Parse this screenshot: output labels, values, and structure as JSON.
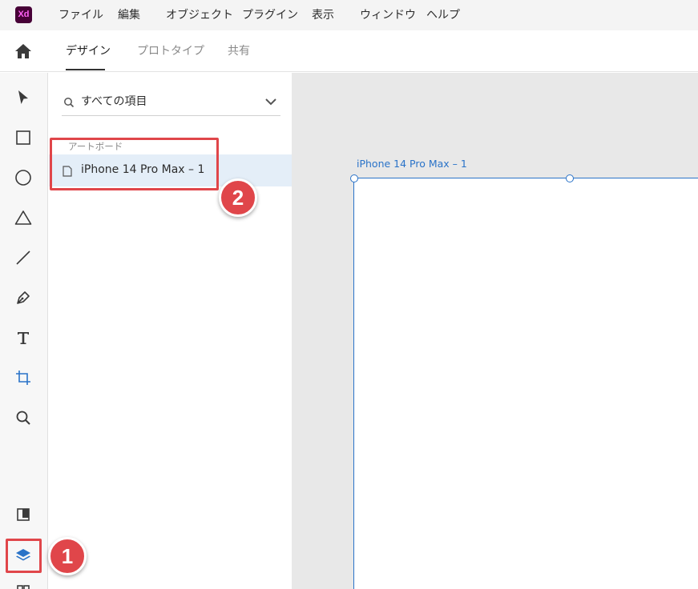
{
  "app": {
    "logo_text": "Xd",
    "logo_color": "#470137",
    "logo_text_color": "#ff61f6"
  },
  "menu": {
    "items": [
      {
        "label": "ファイル"
      },
      {
        "label": "編集"
      },
      {
        "label": "オブジェクト"
      },
      {
        "label": "プラグイン"
      },
      {
        "label": "表示"
      },
      {
        "label": "ウィンドウ"
      },
      {
        "label": "ヘルプ"
      }
    ]
  },
  "tabs": {
    "home_icon": "home-icon",
    "items": [
      {
        "label": "デザイン",
        "active": true
      },
      {
        "label": "プロトタイプ",
        "active": false
      },
      {
        "label": "共有",
        "active": false
      }
    ]
  },
  "toolbar": {
    "tools": [
      {
        "icon": "select-arrow-icon"
      },
      {
        "icon": "rectangle-icon"
      },
      {
        "icon": "ellipse-icon"
      },
      {
        "icon": "polygon-icon"
      },
      {
        "icon": "line-icon"
      },
      {
        "icon": "pen-icon"
      },
      {
        "icon": "text-icon"
      },
      {
        "icon": "artboard-icon",
        "active": true
      },
      {
        "icon": "zoom-icon"
      }
    ],
    "bottom": [
      {
        "icon": "assets-icon"
      },
      {
        "icon": "layers-icon",
        "active": true
      }
    ],
    "accent": "#2a73c8"
  },
  "layers_panel": {
    "search": {
      "value": "すべての項目",
      "icon": "search-icon"
    },
    "section_label": "アートボード",
    "artboards": [
      {
        "name": "iPhone 14 Pro Max – 1",
        "selected": true
      }
    ]
  },
  "canvas": {
    "artboard_title": "iPhone 14 Pro Max – 1",
    "selection_color": "#2a73c8"
  },
  "callouts": [
    {
      "number": "1",
      "color": "#e0464a"
    },
    {
      "number": "2",
      "color": "#e0464a"
    }
  ]
}
